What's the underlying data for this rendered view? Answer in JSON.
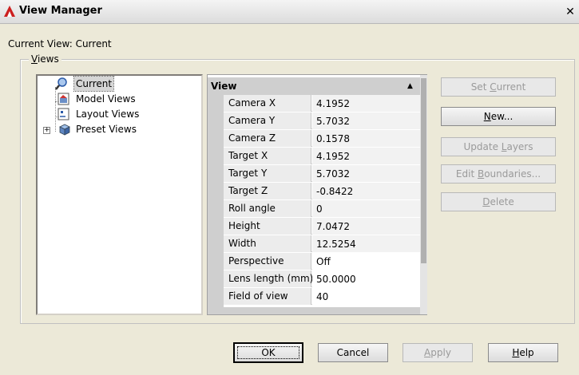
{
  "window": {
    "title": "View Manager",
    "close_label": "✕",
    "icon": "autocad-logo-icon"
  },
  "current_view": "Current View: Current",
  "views_group": {
    "legend_prefix": "",
    "legend_underlined": "V",
    "legend_rest": "iews"
  },
  "tree": {
    "items": [
      {
        "label": "Current",
        "icon": "magnifier-icon",
        "selected": true
      },
      {
        "label": "Model Views",
        "icon": "model-views-icon"
      },
      {
        "label": "Layout Views",
        "icon": "layout-views-icon"
      },
      {
        "label": "Preset Views",
        "icon": "preset-views-icon"
      }
    ]
  },
  "properties": {
    "section": "View",
    "rows": [
      {
        "name": "Camera X",
        "value": "4.1952"
      },
      {
        "name": "Camera Y",
        "value": "5.7032"
      },
      {
        "name": "Camera Z",
        "value": "0.1578"
      },
      {
        "name": "Target X",
        "value": "4.1952"
      },
      {
        "name": "Target Y",
        "value": "5.7032"
      },
      {
        "name": "Target Z",
        "value": "-0.8422"
      },
      {
        "name": "Roll angle",
        "value": "0"
      },
      {
        "name": "Height",
        "value": "7.0472"
      },
      {
        "name": "Width",
        "value": "12.5254"
      },
      {
        "name": "Perspective",
        "value": "Off"
      },
      {
        "name": "Lens length (mm)",
        "value": "50.0000"
      },
      {
        "name": "Field of view",
        "value": "40"
      }
    ]
  },
  "side_buttons": {
    "set_current": {
      "pre": "Set ",
      "u": "C",
      "post": "urrent",
      "enabled": false
    },
    "new": {
      "pre": "",
      "u": "N",
      "post": "ew...",
      "enabled": true
    },
    "update_layers": {
      "pre": "Update ",
      "u": "L",
      "post": "ayers",
      "enabled": false
    },
    "edit_boundaries": {
      "pre": "Edit ",
      "u": "B",
      "post": "oundaries...",
      "enabled": false
    },
    "delete": {
      "pre": "",
      "u": "D",
      "post": "elete",
      "enabled": false
    }
  },
  "bottom_buttons": {
    "ok": "OK",
    "cancel": "Cancel",
    "apply": {
      "pre": "",
      "u": "A",
      "post": "pply",
      "enabled": false
    },
    "help": {
      "pre": "",
      "u": "H",
      "post": "elp",
      "enabled": true
    }
  }
}
